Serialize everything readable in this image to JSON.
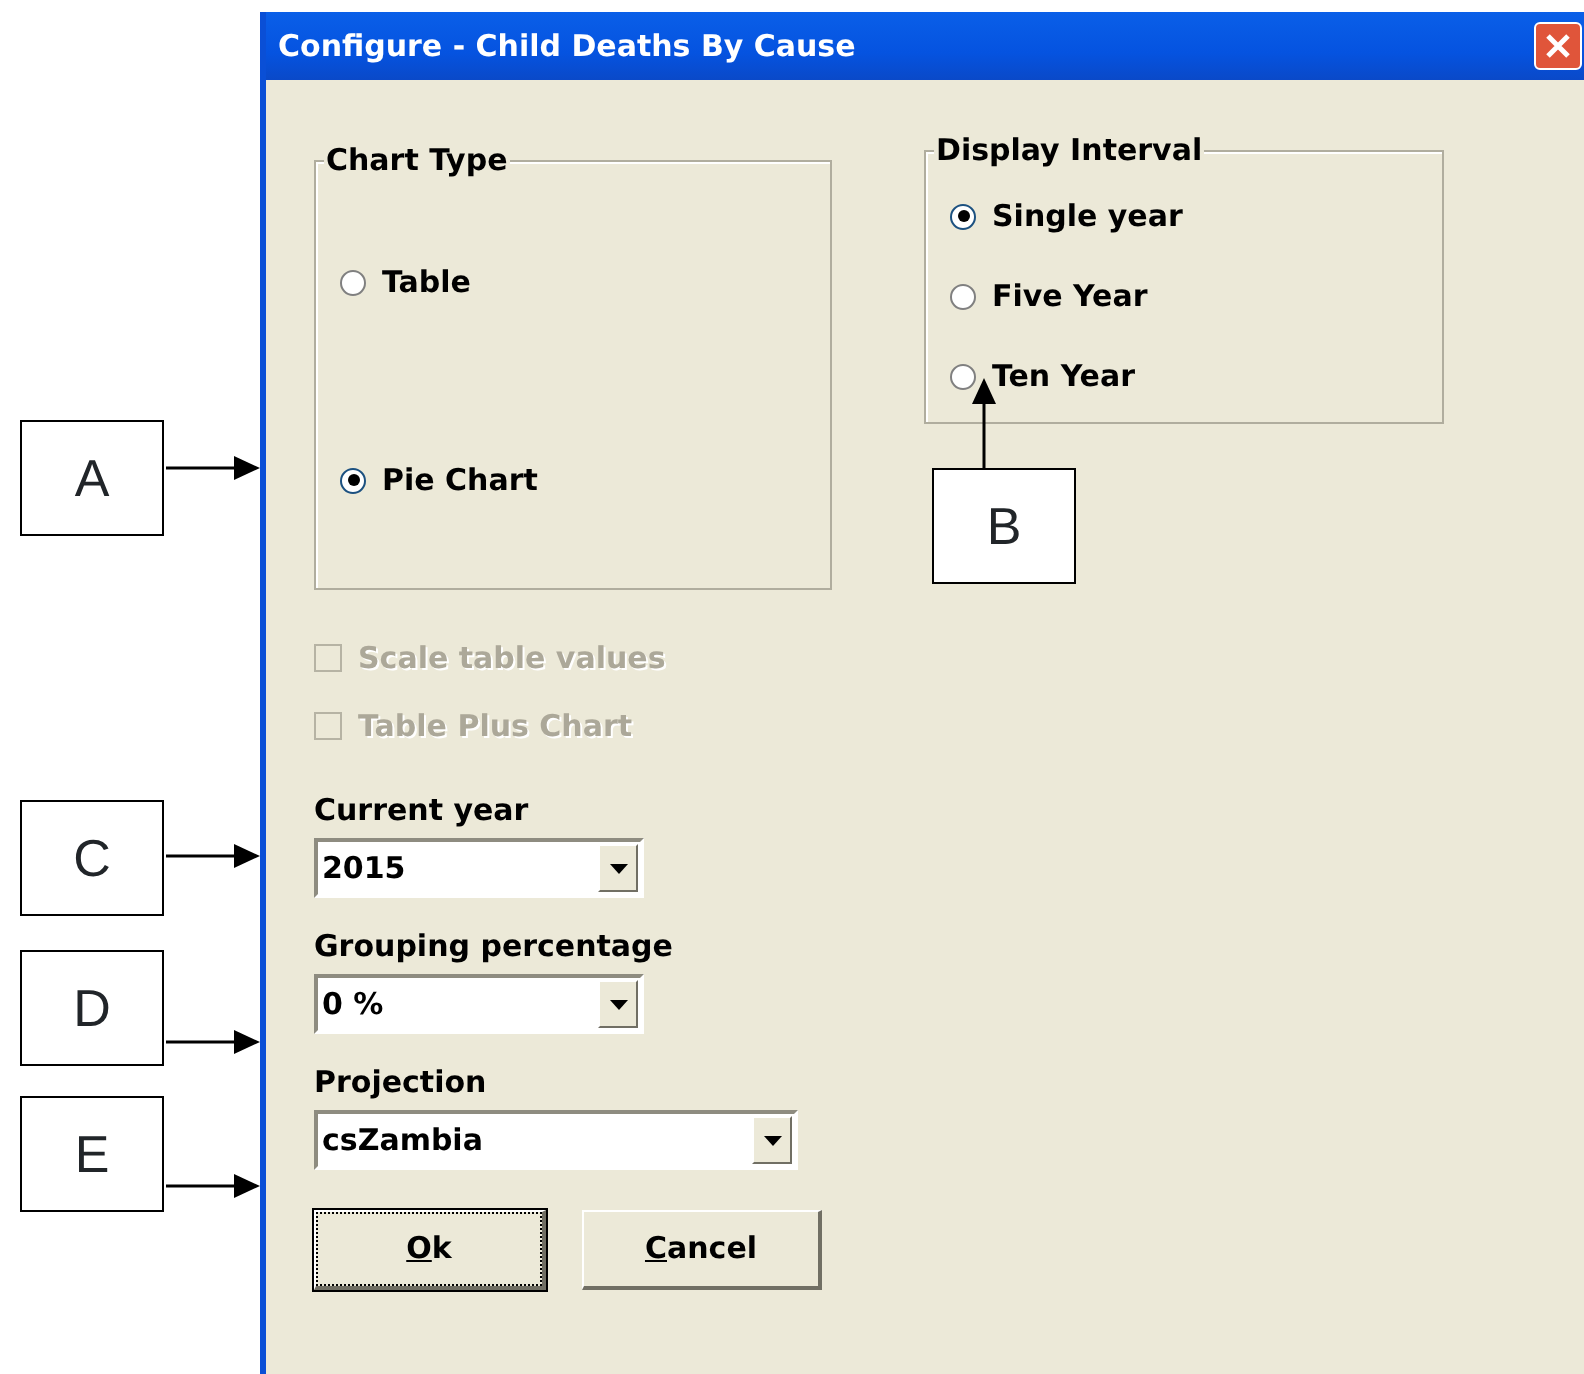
{
  "window": {
    "title": "Configure - Child Deaths By Cause"
  },
  "chart_type": {
    "label": "Chart Type",
    "options": [
      {
        "label": "Table",
        "selected": false
      },
      {
        "label": "Pie Chart",
        "selected": true
      }
    ]
  },
  "display_interval": {
    "label": "Display Interval",
    "options": [
      {
        "label": "Single year",
        "selected": true
      },
      {
        "label": "Five Year",
        "selected": false
      },
      {
        "label": "Ten Year",
        "selected": false
      }
    ]
  },
  "checkboxes": [
    {
      "label": "Scale table values",
      "checked": false,
      "disabled": true
    },
    {
      "label": "Table Plus Chart",
      "checked": false,
      "disabled": true
    }
  ],
  "fields": [
    {
      "label": "Current year",
      "value": "2015"
    },
    {
      "label": "Grouping percentage",
      "value": "0 %"
    },
    {
      "label": "Projection",
      "value": "csZambia"
    }
  ],
  "buttons": [
    {
      "mnemonic": "O",
      "rest": "k",
      "default": true
    },
    {
      "mnemonic": "C",
      "rest": "ancel",
      "default": false
    }
  ],
  "callouts": [
    {
      "letter": "A"
    },
    {
      "letter": "B"
    },
    {
      "letter": "C"
    },
    {
      "letter": "D"
    },
    {
      "letter": "E"
    }
  ]
}
